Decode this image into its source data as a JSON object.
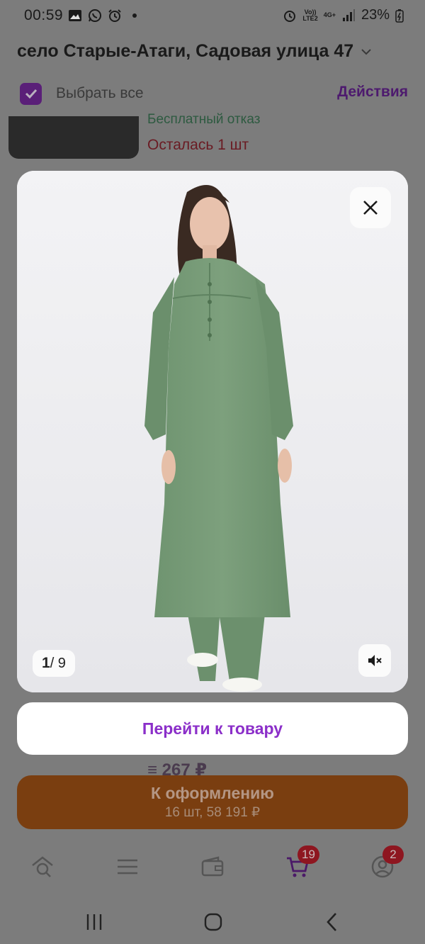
{
  "status": {
    "time": "00:59",
    "net_top": "Vo))",
    "net_bottom": "LTE2",
    "net_type": "4G+",
    "battery": "23%"
  },
  "header": {
    "address": "село Старые-Атаги, Садовая улица 47",
    "select_all_label": "Выбрать все",
    "select_all_checked": true,
    "actions_label": "Действия"
  },
  "background_item": {
    "delivery_text": "Бесплатный отказ",
    "stock_text": "Осталась 1 шт",
    "price_text": "≡ 267 ₽"
  },
  "gallery": {
    "current": "1",
    "total": "/ 9",
    "image_alt": "woman-in-green-tunic-dress"
  },
  "goto_button": "Перейти к товару",
  "checkout": {
    "title": "К оформлению",
    "subtitle": "16 шт, 58 191 ₽"
  },
  "tabbar": {
    "cart_badge": "19",
    "profile_badge": "2"
  },
  "colors": {
    "accent": "#8b2fc9",
    "checkout": "#c25f1a",
    "badge": "#e2283a"
  }
}
